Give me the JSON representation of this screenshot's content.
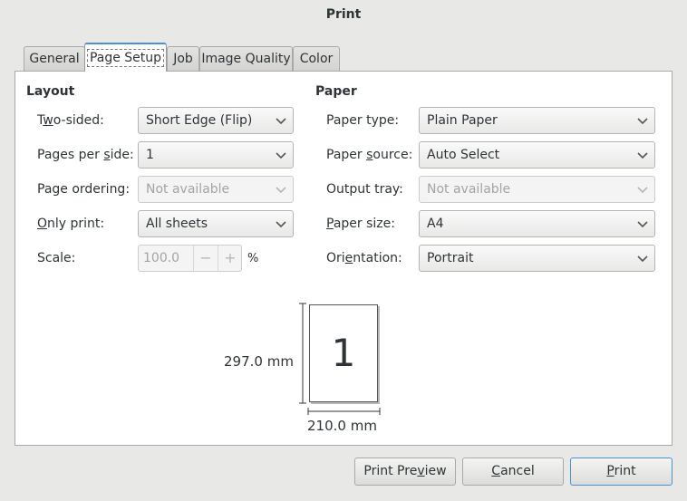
{
  "window": {
    "title": "Print"
  },
  "tabs": [
    {
      "label": "General",
      "active": false
    },
    {
      "label": "Page Setup",
      "active": true
    },
    {
      "label": "Job",
      "active": false
    },
    {
      "label": "Image Quality",
      "active": false
    },
    {
      "label": "Color",
      "active": false
    }
  ],
  "layout": {
    "heading": "Layout",
    "two_sided": {
      "label_pre": "T",
      "label_acc": "w",
      "label_post": "o-sided:",
      "value": "Short Edge (Flip)"
    },
    "pages_per_side": {
      "label_pre": "Pages per ",
      "label_acc": "s",
      "label_post": "ide:",
      "value": "1"
    },
    "page_ordering": {
      "label": "Page ordering:",
      "value": "Not available"
    },
    "only_print": {
      "label_acc": "O",
      "label_post": "nly print:",
      "value": "All sheets"
    },
    "scale": {
      "label": "Scale:",
      "value": "100.0",
      "minus": "−",
      "plus": "+",
      "unit": "%"
    }
  },
  "paper": {
    "heading": "Paper",
    "paper_type": {
      "label": "Paper type:",
      "value": "Plain Paper"
    },
    "paper_source": {
      "label_pre": "Paper ",
      "label_acc": "s",
      "label_post": "ource:",
      "value": "Auto Select"
    },
    "output_tray": {
      "label": "Output tray:",
      "value": "Not available"
    },
    "paper_size": {
      "label_acc": "P",
      "label_post": "aper size:",
      "value": "A4"
    },
    "orientation": {
      "label_pre": "Ori",
      "label_acc": "e",
      "label_post": "ntation:",
      "value": "Portrait"
    }
  },
  "preview": {
    "page_number": "1",
    "height_label": "297.0 mm",
    "width_label": "210.0 mm"
  },
  "buttons": {
    "preview_pre": "Print Pre",
    "preview_acc": "v",
    "preview_post": "iew",
    "cancel_acc": "C",
    "cancel_post": "ancel",
    "print_acc": "P",
    "print_post": "rint"
  },
  "icons": {
    "chevron": "chevron-down-icon"
  },
  "colors": {
    "accent": "#4a90d9",
    "panel": "#ffffff",
    "window_bg": "#e8e8e7"
  }
}
